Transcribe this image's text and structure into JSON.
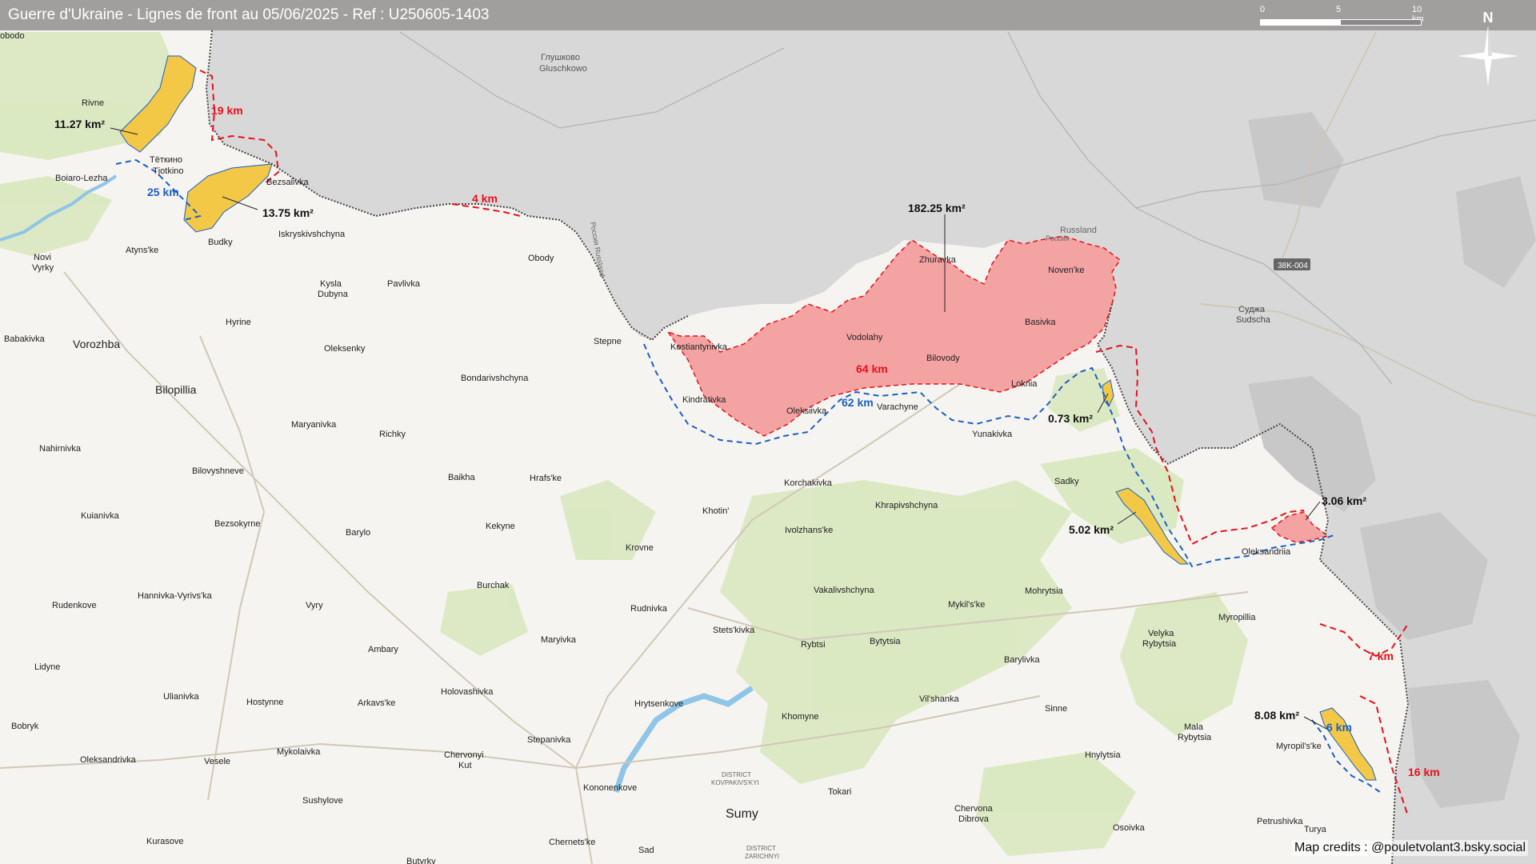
{
  "title": "Guerre d'Ukraine - Lignes de front au 05/06/2025 - Ref : U250605-1403",
  "scale": {
    "t0": "0",
    "t5": "5",
    "t10": "10 km"
  },
  "compass": "N",
  "credits": "Map credits : @pouletvolant3.bsky.social",
  "colors": {
    "russia": "#d9d9d9",
    "ukraine": "#f6f4f0",
    "pink_area": "#f4a3a3",
    "yellow_area": "#f3c847",
    "red_line": "#e8101a",
    "blue_line": "#1a5fc4",
    "forest": "#d8e6bd",
    "water": "#8fc5e6"
  },
  "areas": {
    "a1": "11.27 km²",
    "a2": "13.75 km²",
    "a3": "182.25 km²",
    "a4": "0.73 km²",
    "a5": "5.02 km²",
    "a6": "3.06 km²",
    "a7": "8.08 km²"
  },
  "distances": {
    "d19": "19 km",
    "d25": "25 km",
    "d4": "4 km",
    "d64": "64 km",
    "d62": "62 km",
    "d7": "7 km",
    "d6": "6 km",
    "d16": "16 km"
  },
  "places": {
    "obodo": "obodo",
    "rivne": "Rivne",
    "tetkino": "Тёткино",
    "tjotkino": "Tjotkino",
    "boiaro": "Boiaro-Lezha",
    "bezsalivka": "Bezsalivka",
    "budky": "Budky",
    "iskryskivshchyna": "Iskryskivshchyna",
    "atynske": "Atyns'ke",
    "novi_vyrky": "Novi\nVyrky",
    "novi": "Novi",
    "vyrky": "Vyrky",
    "glushkovo_ru": "Глушково",
    "glushkovo": "Gluschkowo",
    "obody": "Obody",
    "kysla": "Kysla",
    "dubyna": "Dubyna",
    "pavlivka": "Pavlivka",
    "hyrine": "Hyrine",
    "babakivka": "Babakivka",
    "vorozhba": "Vorozhba",
    "oleksenky": "Oleksenky",
    "stepne": "Stepne",
    "bondarivshchyna": "Bondarivshchyna",
    "bilopillia": "Bilopillia",
    "maryanivka": "Maryanivka",
    "richky": "Richky",
    "nahirnivka": "Nahirnivka",
    "bilovyshneve": "Bilovyshneve",
    "baikha": "Baikha",
    "hrafske": "Hrafs'ke",
    "kuianivka": "Kuianivka",
    "bezsokyrne": "Bezsokyrne",
    "barylo": "Barylo",
    "kekyne": "Kekyne",
    "krovne": "Krovne",
    "hannivka": "Hannivka-Vyrivs'ka",
    "rudenkove": "Rudenkove",
    "vyry": "Vyry",
    "burchak": "Burchak",
    "rudnivka": "Rudnivka",
    "ambary": "Ambary",
    "maryivka": "Maryivka",
    "lidyne": "Lidyne",
    "ulianivka": "Ulianivka",
    "holovashivka": "Holovashivka",
    "hostynne": "Hostynne",
    "arkavske": "Arkavs'ke",
    "bobryk": "Bobryk",
    "oleksandrivka": "Oleksandrivka",
    "vesele": "Vesele",
    "mykolaivka": "Mykolaivka",
    "chervonyi_kut": "Chervonyi\nKut",
    "chervonyi": "Chervonyi",
    "kut": "Kut",
    "stepanivka": "Stepanivka",
    "sushylove": "Sushylove",
    "kononenkove": "Kononenkove",
    "kurasove": "Kurasove",
    "chernetske": "Chernets'ke",
    "sad": "Sad",
    "butyrky": "Butyrky",
    "sumy": "Sumy",
    "district1": "DISTRICT",
    "district1b": "KOVPAKIVS'KYI",
    "district2": "DISTRICT",
    "district2b": "ZARICHNYI",
    "kostiantynivka": "Kostiantynivka",
    "kindrativka": "Kindrativka",
    "oleksiivka": "Oleksiivka",
    "vodolahy": "Vodolahy",
    "zhuravka": "Zhuravka",
    "bilovody": "Bilovody",
    "varachyne": "Varachyne",
    "yunakivka": "Yunakivka",
    "loknia": "Loknia",
    "basivka": "Basivka",
    "novenke": "Noven'ke",
    "russland": "Russland",
    "rossiya": "Россия",
    "russland_v": "Россия Russland",
    "sadky": "Sadky",
    "korchakivka": "Korchakivka",
    "khotin": "Khotin'",
    "khrapivshchyna": "Khrapivshchyna",
    "ivolzhanske": "Ivolzhans'ke",
    "stetskivka": "Stets'kivka",
    "vakalivshchyna": "Vakalivshchyna",
    "mykilske": "Mykil's'ke",
    "mohrytsia": "Mohrytsia",
    "rybtsi": "Rybtsi",
    "bytytsia": "Bytytsia",
    "barylivka": "Barylivka",
    "vilshanka": "Vil'shanka",
    "hrytsenkove": "Hrytsenkove",
    "khomyne": "Khomyne",
    "sinne": "Sinne",
    "tokari": "Tokari",
    "chervona": "Chervona",
    "dibrova": "Dibrova",
    "hnylytsia": "Hnylytsia",
    "osoivka": "Osoivka",
    "velyka": "Velyka",
    "rybytsia": "Rybytsia",
    "mala": "Mala",
    "mala_rybytsia": "Rybytsia",
    "myropillia": "Myropillia",
    "myropilske": "Myropil's'ke",
    "oleksandriia": "Oleksandriia",
    "petrushivka": "Petrushivka",
    "turya": "Turya",
    "sudzha_ru": "Суджа",
    "sudzha": "Sudscha",
    "road": "38K-004"
  }
}
